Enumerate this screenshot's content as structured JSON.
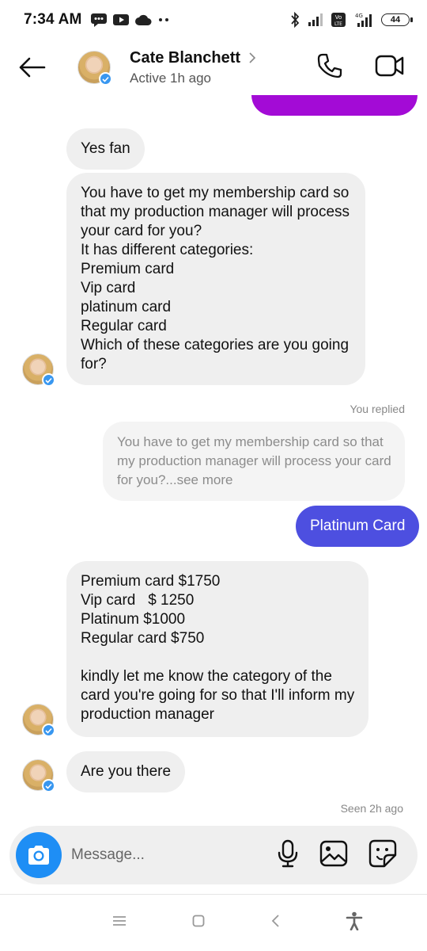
{
  "status_bar": {
    "time": "7:34 AM",
    "battery": "44",
    "network": "4G",
    "volte": "Vo LTE"
  },
  "header": {
    "name": "Cate Blanchett",
    "status": "Active 1h ago"
  },
  "messages": {
    "top_cutoff": "",
    "m1": "Yes fan",
    "m2": [
      "You have to get my membership card so",
      "that my production manager will process",
      "your card for you?",
      "It has different categories:",
      "Premium card",
      "Vip card",
      "platinum card",
      "Regular card",
      "Which of these categories are you going",
      "for?"
    ],
    "you_replied": "You replied",
    "quote": [
      "You have to get my membership card so that",
      "my production manager will process your card",
      "for you?...see more"
    ],
    "sent": "Platinum Card",
    "m3": [
      "Premium card $1750",
      "Vip card   $ 1250",
      "Platinum $1000",
      "Regular card $750",
      "",
      "kindly let me know the category of the",
      "card you're going for so that I'll inform my",
      "production manager"
    ],
    "m4": "Are you there",
    "seen": "Seen 2h ago"
  },
  "composer": {
    "placeholder": "Message..."
  },
  "icons": {
    "back": "back-arrow-icon",
    "call": "phone-icon",
    "video": "video-camera-icon",
    "camera": "camera-icon",
    "mic": "microphone-icon",
    "gallery": "image-icon",
    "sticker": "sticker-icon"
  },
  "colors": {
    "sent_bubble": "#4d4fe0",
    "top_bubble": "#a30bd6",
    "camera_button": "#1e8ef5",
    "verified": "#3897f0",
    "incoming_bubble": "#efefef"
  }
}
